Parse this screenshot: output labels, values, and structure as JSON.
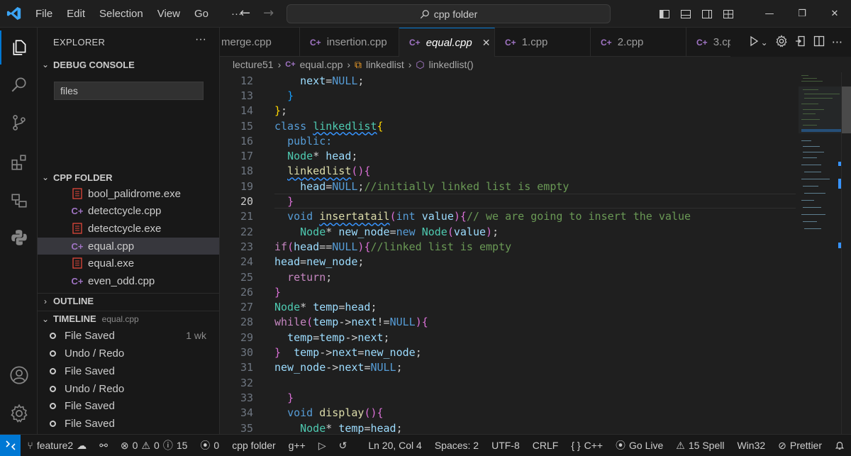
{
  "menu": [
    "File",
    "Edit",
    "Selection",
    "View",
    "Go"
  ],
  "menu_more": "···",
  "search": {
    "text": "cpp folder"
  },
  "sidebar": {
    "header": "EXPLORER",
    "more": "···",
    "debug_console": {
      "title": "DEBUG CONSOLE",
      "filter_value": "files"
    },
    "cpp_folder": {
      "title": "CPP FOLDER",
      "files": [
        {
          "name": "bool_palidrome.exe",
          "type": "exe"
        },
        {
          "name": "detectcycle.cpp",
          "type": "cpp"
        },
        {
          "name": "detectcycle.exe",
          "type": "exe"
        },
        {
          "name": "equal.cpp",
          "type": "cpp",
          "selected": true
        },
        {
          "name": "equal.exe",
          "type": "exe"
        },
        {
          "name": "even_odd.cpp",
          "type": "cpp"
        }
      ]
    },
    "outline": {
      "title": "OUTLINE"
    },
    "timeline": {
      "title": "TIMELINE",
      "file": "equal.cpp",
      "items": [
        {
          "label": "File Saved",
          "age": "1 wk"
        },
        {
          "label": "Undo / Redo",
          "age": ""
        },
        {
          "label": "File Saved",
          "age": ""
        },
        {
          "label": "Undo / Redo",
          "age": ""
        },
        {
          "label": "File Saved",
          "age": ""
        },
        {
          "label": "File Saved",
          "age": ""
        }
      ]
    }
  },
  "tabs": [
    {
      "label": "merge.cpp",
      "active": false
    },
    {
      "label": "insertion.cpp",
      "active": false
    },
    {
      "label": "equal.cpp",
      "active": true
    },
    {
      "label": "1.cpp",
      "active": false
    },
    {
      "label": "2.cpp",
      "active": false
    },
    {
      "label": "3.cp",
      "active": false
    }
  ],
  "breadcrumb": {
    "folder": "lecture51",
    "file": "equal.cpp",
    "class": "linkedlist",
    "method": "linkedlist()"
  },
  "editor": {
    "current_line": 20,
    "lines": [
      {
        "n": 12,
        "ind": 2,
        "t": [
          [
            "va",
            "next"
          ],
          [
            "",
            "="
          ],
          [
            "kw",
            "NULL"
          ],
          [
            "",
            ";"
          ]
        ]
      },
      {
        "n": 13,
        "ind": 1,
        "t": [
          [
            "br2",
            "}"
          ]
        ]
      },
      {
        "n": 14,
        "ind": 0,
        "t": [
          [
            "br3",
            "}"
          ],
          [
            "",
            ";"
          ]
        ]
      },
      {
        "n": 15,
        "ind": 0,
        "t": [
          [
            "kw",
            "class "
          ],
          [
            "ty sq",
            "linkedlist"
          ],
          [
            "br3",
            "{"
          ]
        ]
      },
      {
        "n": 16,
        "ind": 1,
        "t": [
          [
            "kw",
            "public:"
          ]
        ]
      },
      {
        "n": 17,
        "ind": 1,
        "t": [
          [
            "ty",
            "Node"
          ],
          [
            "",
            "* "
          ],
          [
            "va",
            "head"
          ],
          [
            "",
            ";"
          ]
        ]
      },
      {
        "n": 18,
        "ind": 1,
        "t": [
          [
            "fn sq",
            "linkedlist"
          ],
          [
            "br1",
            "()"
          ],
          [
            "br1",
            "{"
          ]
        ]
      },
      {
        "n": 19,
        "ind": 2,
        "t": [
          [
            "va",
            "head"
          ],
          [
            "",
            "="
          ],
          [
            "kw",
            "NULL"
          ],
          [
            "",
            ";"
          ],
          [
            "cm",
            "//initially linked list is empty"
          ]
        ]
      },
      {
        "n": 20,
        "ind": 1,
        "t": [
          [
            "br1",
            "}"
          ]
        ]
      },
      {
        "n": 21,
        "ind": 1,
        "t": [
          [
            "kw",
            "void "
          ],
          [
            "fn sq",
            "insertatail"
          ],
          [
            "br1",
            "("
          ],
          [
            "kw",
            "int "
          ],
          [
            "va",
            "value"
          ],
          [
            "br1",
            ")"
          ],
          [
            "br1",
            "{"
          ],
          [
            "cm",
            "// we are going to insert the value"
          ]
        ]
      },
      {
        "n": 22,
        "ind": 2,
        "t": [
          [
            "ty",
            "Node"
          ],
          [
            "",
            "* "
          ],
          [
            "va",
            "new_node"
          ],
          [
            "",
            "="
          ],
          [
            "kw",
            "new "
          ],
          [
            "ty",
            "Node"
          ],
          [
            "br1",
            "("
          ],
          [
            "va",
            "value"
          ],
          [
            "br1",
            ")"
          ],
          [
            "",
            ";"
          ]
        ]
      },
      {
        "n": 23,
        "ind": 0,
        "t": [
          [
            "ctl",
            "if"
          ],
          [
            "br1",
            "("
          ],
          [
            "va",
            "head"
          ],
          [
            "",
            "=="
          ],
          [
            "kw",
            "NULL"
          ],
          [
            "br1",
            ")"
          ],
          [
            "br1",
            "{"
          ],
          [
            "cm",
            "//linked list is empty"
          ]
        ]
      },
      {
        "n": 24,
        "ind": 0,
        "t": [
          [
            "va",
            "head"
          ],
          [
            "",
            "="
          ],
          [
            "va",
            "new_node"
          ],
          [
            "",
            ";"
          ]
        ]
      },
      {
        "n": 25,
        "ind": 1,
        "t": [
          [
            "ctl",
            "return"
          ],
          [
            "",
            ";"
          ]
        ]
      },
      {
        "n": 26,
        "ind": 0,
        "t": [
          [
            "br1",
            "}"
          ]
        ]
      },
      {
        "n": 27,
        "ind": 0,
        "t": [
          [
            "ty",
            "Node"
          ],
          [
            "",
            "* "
          ],
          [
            "va",
            "temp"
          ],
          [
            "",
            "="
          ],
          [
            "va",
            "head"
          ],
          [
            "",
            ";"
          ]
        ]
      },
      {
        "n": 28,
        "ind": 0,
        "t": [
          [
            "ctl",
            "while"
          ],
          [
            "br1",
            "("
          ],
          [
            "va",
            "temp"
          ],
          [
            "",
            "->"
          ],
          [
            "va",
            "next"
          ],
          [
            "",
            "!="
          ],
          [
            "kw",
            "NULL"
          ],
          [
            "br1",
            ")"
          ],
          [
            "br1",
            "{"
          ]
        ]
      },
      {
        "n": 29,
        "ind": 1,
        "t": [
          [
            "va",
            "temp"
          ],
          [
            "",
            "="
          ],
          [
            "va",
            "temp"
          ],
          [
            "",
            "->"
          ],
          [
            "va",
            "next"
          ],
          [
            "",
            ";"
          ]
        ]
      },
      {
        "n": 30,
        "ind": 0,
        "t": [
          [
            "br1",
            "}"
          ],
          [
            "",
            "  "
          ],
          [
            "va",
            "temp"
          ],
          [
            "",
            "->"
          ],
          [
            "va",
            "next"
          ],
          [
            "",
            "="
          ],
          [
            "va",
            "new_node"
          ],
          [
            "",
            ";"
          ]
        ]
      },
      {
        "n": 31,
        "ind": 0,
        "t": [
          [
            "va",
            "new_node"
          ],
          [
            "",
            "->"
          ],
          [
            "va",
            "next"
          ],
          [
            "",
            "="
          ],
          [
            "kw",
            "NULL"
          ],
          [
            "",
            ";"
          ]
        ]
      },
      {
        "n": 32,
        "ind": 0,
        "t": []
      },
      {
        "n": 33,
        "ind": 1,
        "t": [
          [
            "br1",
            "}"
          ]
        ]
      },
      {
        "n": 34,
        "ind": 1,
        "t": [
          [
            "kw",
            "void "
          ],
          [
            "fn",
            "display"
          ],
          [
            "br1",
            "()"
          ],
          [
            "br1",
            "{"
          ]
        ]
      },
      {
        "n": 35,
        "ind": 2,
        "t": [
          [
            "ty",
            "Node"
          ],
          [
            "",
            "* "
          ],
          [
            "va",
            "temp"
          ],
          [
            "",
            "="
          ],
          [
            "va",
            "head"
          ],
          [
            "",
            ";"
          ]
        ]
      }
    ]
  },
  "status": {
    "branch": "feature2",
    "errors": "0",
    "warnings": "0",
    "info": "15",
    "ports": "0",
    "folder": "cpp folder",
    "compiler": "g++",
    "position": "Ln 20, Col 4",
    "spaces": "Spaces: 2",
    "encoding": "UTF-8",
    "eol": "CRLF",
    "language": "C++",
    "golive": "Go Live",
    "spell": "15 Spell",
    "platform": "Win32",
    "prettier": "Prettier"
  },
  "colors": {
    "accent": "#0078d4",
    "background": "#1f1f1f",
    "sidebar": "#181818"
  }
}
